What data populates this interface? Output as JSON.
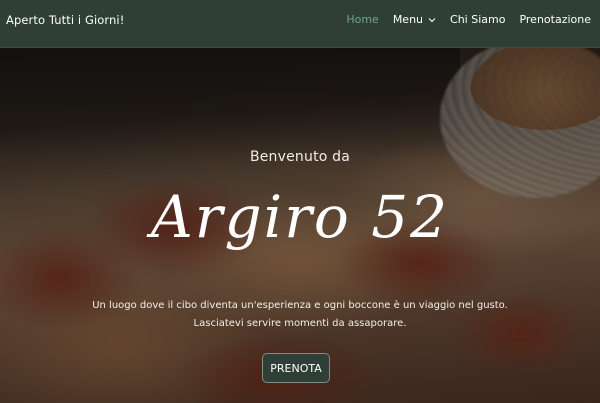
{
  "header": {
    "brand_text": "Aperto Tutti i Giorni!",
    "nav": [
      {
        "label": "Home",
        "active": true
      },
      {
        "label": "Menu",
        "has_dropdown": true
      },
      {
        "label": "Chi Siamo"
      },
      {
        "label": "Prenotazione"
      }
    ]
  },
  "hero": {
    "welcome": "Benvenuto da",
    "title": "Argiro 52",
    "tagline_line1": "Un luogo dove il cibo diventa un'esperienza e ogni boccone è un viaggio nel gusto.",
    "tagline_line2": "Lasciatevi servire momenti da assaporare.",
    "cta_label": "PRENOTA"
  },
  "colors": {
    "header_bg": "#2f3e37",
    "nav_active": "#6fa48d",
    "button_bg": "#2f3e37"
  }
}
